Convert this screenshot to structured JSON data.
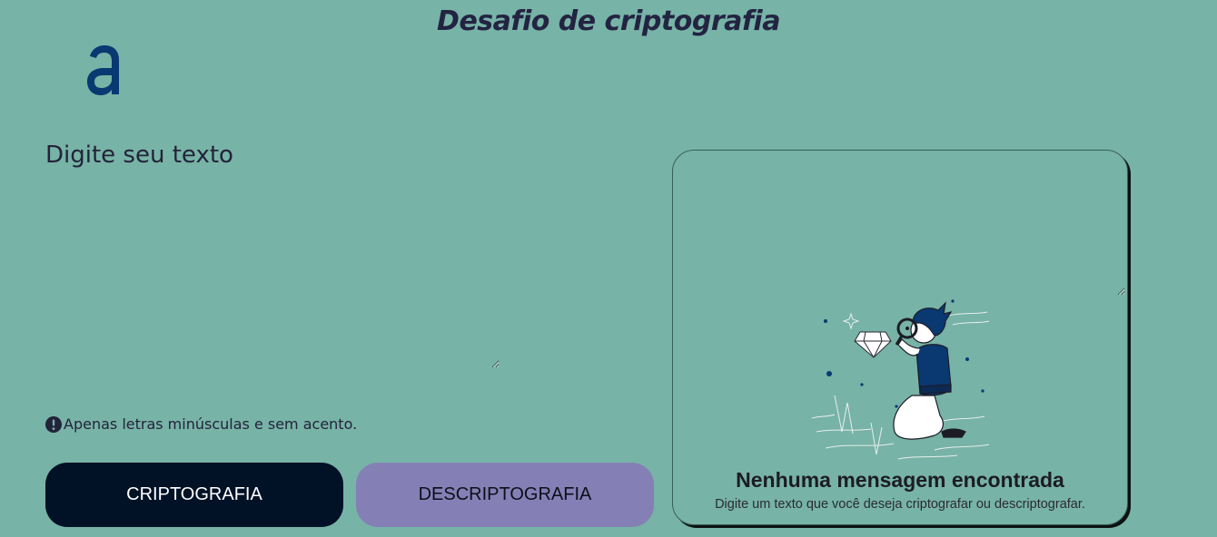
{
  "header": {
    "title": "Desafio de criptografia",
    "logo": "alura-logo"
  },
  "input": {
    "placeholder": "Digite seu texto",
    "value": ""
  },
  "notice": {
    "icon": "exclamation-circle-icon",
    "text": "Apenas letras minúsculas e sem acento."
  },
  "buttons": {
    "encrypt_label": "CRIPTOGRAFIA",
    "decrypt_label": "DESCRIPTOGRAFIA"
  },
  "output": {
    "value": "",
    "illustration": "detective-with-magnifying-glass-and-diamond",
    "empty_title": "Nenhuma mensagem encontrada",
    "empty_description": "Digite um texto que você deseja criptografar ou descriptografar."
  },
  "colors": {
    "background": "#77b3a6",
    "primary_button": "#011126",
    "secondary_button": "#8480b5",
    "logo": "#0a3871"
  }
}
